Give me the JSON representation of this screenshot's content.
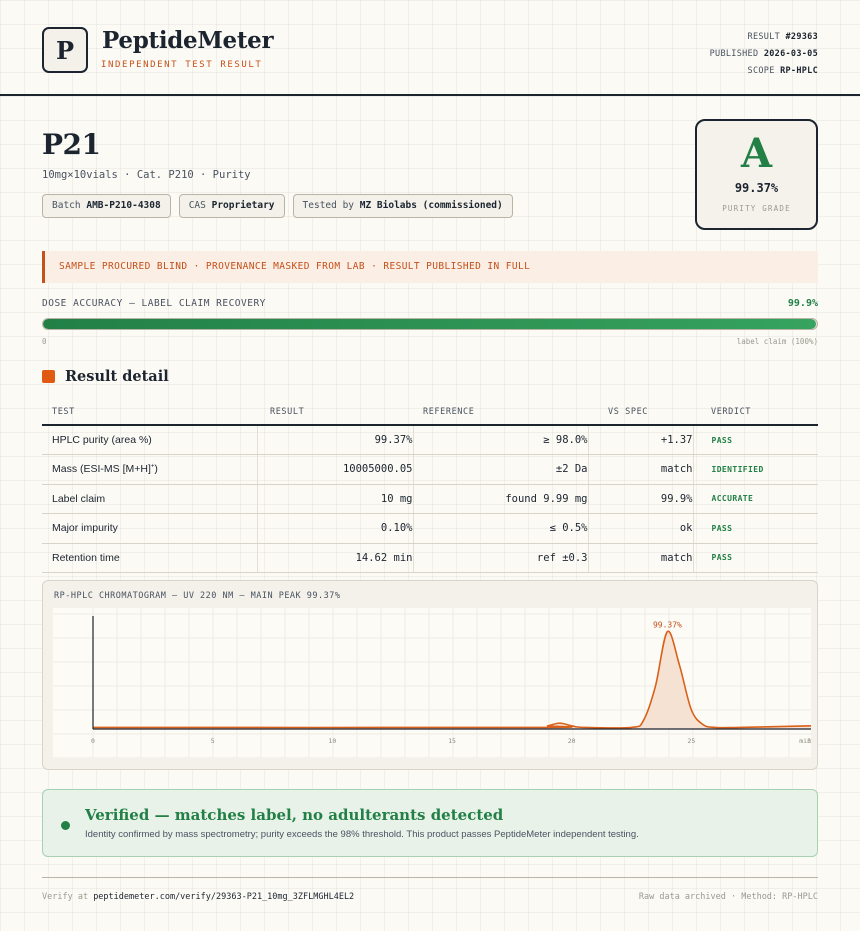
{
  "header": {
    "logo_letter": "P",
    "brand": "PeptideMeter",
    "brand_sub": "INDEPENDENT TEST RESULT",
    "result_label": "RESULT",
    "result_id": "#29363",
    "published_label": "PUBLISHED",
    "published_date": "2026-03-05",
    "scope_label": "SCOPE",
    "scope_value": "RP-HPLC"
  },
  "product": {
    "name": "P21",
    "subtitle": "10mg×10vials · Cat. P210 · Purity",
    "batch_label": "Batch",
    "batch_value": "AMB-P210-4308",
    "cas_label": "CAS",
    "cas_value": "Proprietary",
    "tested_label": "Tested by",
    "tested_value": "MZ Biolabs (commissioned)"
  },
  "grade": {
    "letter": "A",
    "value": "99.37%",
    "label": "PURITY GRADE"
  },
  "notice": "SAMPLE PROCURED BLIND · PROVENANCE MASKED FROM LAB · RESULT PUBLISHED IN FULL",
  "dose": {
    "label": "DOSE ACCURACY — LABEL CLAIM RECOVERY",
    "value": "99.9%",
    "fill_percent": 99.9,
    "min_label": "0",
    "max_label": "label claim (100%)"
  },
  "section_title": "Result detail",
  "table": {
    "headers": {
      "test": "TEST",
      "result": "RESULT",
      "reference": "REFERENCE",
      "vs_spec": "VS SPEC",
      "verdict": "VERDICT"
    },
    "rows": [
      {
        "test": "HPLC purity (area %)",
        "result": "99.37%",
        "reference": "≥ 98.0%",
        "vs_spec": "+1.37",
        "verdict": "PASS"
      },
      {
        "test": "Mass (ESI-MS [M+H]",
        "test_sup": "+",
        "test_end": ")",
        "result": "10005000.05",
        "reference": "±2 Da",
        "vs_spec": "match",
        "verdict": "IDENTIFIED"
      },
      {
        "test": "Label claim",
        "result": "10 mg",
        "reference": "found 9.99 mg",
        "vs_spec": "99.9%",
        "verdict": "ACCURATE"
      },
      {
        "test": "Major impurity",
        "result": "0.10%",
        "reference": "≤ 0.5%",
        "vs_spec": "ok",
        "verdict": "PASS"
      },
      {
        "test": "Retention time",
        "result": "14.62 min",
        "reference": "ref ±0.3",
        "vs_spec": "match",
        "verdict": "PASS"
      }
    ]
  },
  "chromatogram": {
    "label": "RP-HPLC CHROMATOGRAM — UV 220 NM — MAIN PEAK 99.37%"
  },
  "chart_data": {
    "type": "line",
    "title": "RP-HPLC CHROMATOGRAM — UV 220 NM — MAIN PEAK 99.37%",
    "xlabel": "",
    "ylabel": "",
    "x_ticks": [
      "0",
      "5",
      "10",
      "15",
      "20",
      "25",
      "30"
    ],
    "x_end_label": "min",
    "xlim": [
      0,
      30
    ],
    "ylim": [
      0,
      100
    ],
    "peak_label": "99.37%",
    "series": [
      {
        "x": [
          0,
          18.5,
          19,
          19.5,
          20,
          20.5,
          22.5,
          23,
          23.5,
          24,
          24.5,
          25,
          25.5,
          26,
          27,
          30
        ],
        "values": [
          1.5,
          1.5,
          3,
          5.5,
          3,
          1.5,
          1.5,
          8,
          40,
          91,
          60,
          18,
          4,
          1.5,
          1.5,
          3
        ]
      }
    ],
    "line_color": "#d9601a",
    "fill_color": "#f6e2d2",
    "grid": true
  },
  "verified": {
    "title": "Verified — matches label, no adulterants detected",
    "text": "Identity confirmed by mass spectrometry; purity exceeds the 98% threshold. This product passes PeptideMeter independent testing."
  },
  "footer": {
    "verify_label": "Verify at",
    "verify_url": "peptidemeter.com/verify/29363-P21_10mg_3ZFLMGHL4EL2",
    "right_text": "Raw data archived · Method: RP-HPLC"
  },
  "colors": {
    "accent_orange": "#c4501a",
    "pass_green": "#228047",
    "ink": "#1c2430"
  }
}
